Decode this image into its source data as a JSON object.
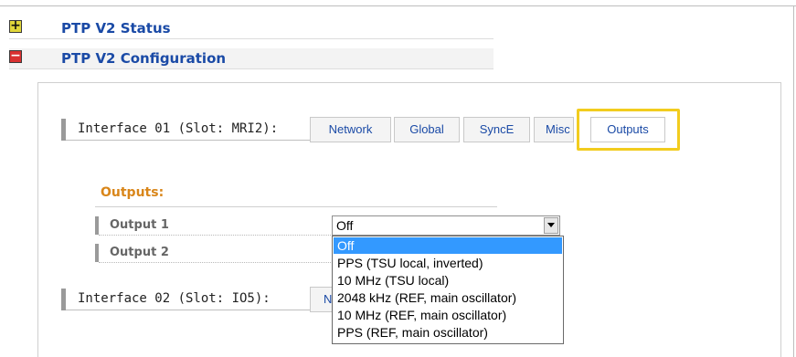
{
  "sections": [
    {
      "title": "PTP V2 Status",
      "toggle": "+",
      "expanded": false,
      "icon": "expand-plus-icon"
    },
    {
      "title": "PTP V2 Configuration",
      "toggle": "−",
      "expanded": true,
      "icon": "collapse-minus-icon"
    }
  ],
  "interfaces": [
    {
      "label": "Interface 01 (Slot: MRI2):"
    },
    {
      "label": "Interface 02 (Slot: IO5):"
    }
  ],
  "tabs": [
    {
      "label": "Network",
      "active": false
    },
    {
      "label": "Global",
      "active": false
    },
    {
      "label": "SyncE",
      "active": false
    },
    {
      "label": "Misc",
      "active": false
    },
    {
      "label": "Outputs",
      "active": true
    }
  ],
  "interface2_tab_partial": "N",
  "outputs": {
    "heading": "Outputs:",
    "fields": [
      {
        "label": "Output 1",
        "value": "Off"
      },
      {
        "label": "Output 2"
      }
    ]
  },
  "dropdown": {
    "selected": "Off",
    "options": [
      "Off",
      "PPS (TSU local, inverted)",
      "10 MHz (TSU local)",
      "2048 kHz (REF, main oscillator)",
      "10 MHz (REF, main oscillator)",
      "PPS (REF, main oscillator)"
    ]
  },
  "colors": {
    "section_title": "#1a4aa6",
    "outputs_heading": "#d9861a",
    "highlight": "#f2cc1e",
    "selected_option": "#3399ff"
  }
}
